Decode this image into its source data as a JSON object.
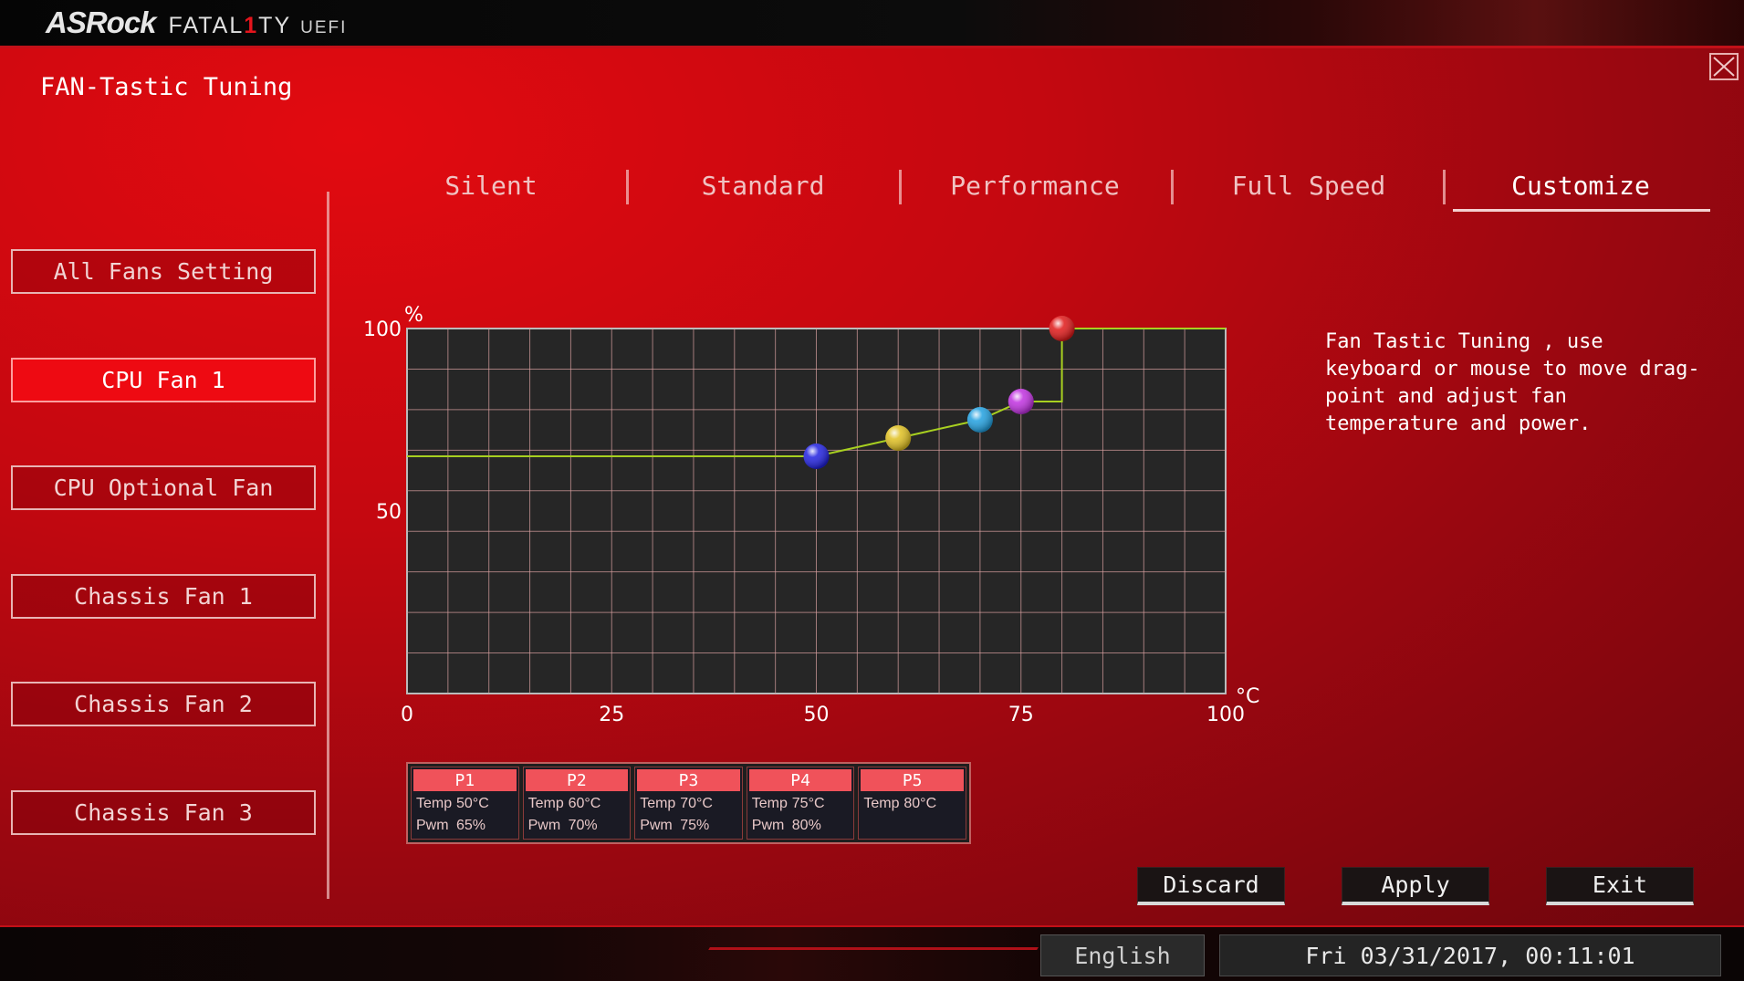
{
  "header": {
    "brand": "ASRock",
    "brand_sub_a": "FATAL",
    "brand_sub_one": "1",
    "brand_sub_b": "TY",
    "brand_uefi": "UEFI"
  },
  "page": {
    "title": "FAN-Tastic Tuning"
  },
  "sidebar": {
    "items": [
      {
        "label": "All Fans Setting",
        "active": false
      },
      {
        "label": "CPU Fan 1",
        "active": true
      },
      {
        "label": "CPU Optional Fan",
        "active": false
      },
      {
        "label": "Chassis Fan 1",
        "active": false
      },
      {
        "label": "Chassis Fan 2",
        "active": false
      },
      {
        "label": "Chassis Fan 3",
        "active": false
      }
    ]
  },
  "tabs": [
    {
      "label": "Silent",
      "active": false
    },
    {
      "label": "Standard",
      "active": false
    },
    {
      "label": "Performance",
      "active": false
    },
    {
      "label": "Full Speed",
      "active": false
    },
    {
      "label": "Customize",
      "active": true
    }
  ],
  "chart_data": {
    "type": "line",
    "y_unit": "%",
    "x_unit": "°C",
    "xlim": [
      0,
      100
    ],
    "ylim": [
      0,
      100
    ],
    "x_ticks": [
      "0",
      "25",
      "50",
      "75",
      "100"
    ],
    "y_ticks": [
      "100",
      "50"
    ],
    "grid": true,
    "curve": [
      {
        "x": 0,
        "y": 65
      },
      {
        "x": 50,
        "y": 65
      },
      {
        "x": 60,
        "y": 70
      },
      {
        "x": 70,
        "y": 75
      },
      {
        "x": 75,
        "y": 80
      },
      {
        "x": 80,
        "y": 80
      },
      {
        "x": 80,
        "y": 100
      },
      {
        "x": 100,
        "y": 100
      }
    ],
    "points": [
      {
        "name": "P1",
        "x": 50,
        "y": 65,
        "color": "#2020e0"
      },
      {
        "name": "P2",
        "x": 60,
        "y": 70,
        "color": "#e0c020"
      },
      {
        "name": "P3",
        "x": 70,
        "y": 75,
        "color": "#20a0e0"
      },
      {
        "name": "P4",
        "x": 75,
        "y": 80,
        "color": "#c030e0"
      },
      {
        "name": "P5",
        "x": 80,
        "y": 100,
        "color": "#e01818"
      }
    ]
  },
  "points_table": [
    {
      "name": "P1",
      "temp_label": "Temp",
      "temp": "50°C",
      "pwm_label": "Pwm",
      "pwm": "65%"
    },
    {
      "name": "P2",
      "temp_label": "Temp",
      "temp": "60°C",
      "pwm_label": "Pwm",
      "pwm": "70%"
    },
    {
      "name": "P3",
      "temp_label": "Temp",
      "temp": "70°C",
      "pwm_label": "Pwm",
      "pwm": "75%"
    },
    {
      "name": "P4",
      "temp_label": "Temp",
      "temp": "75°C",
      "pwm_label": "Pwm",
      "pwm": "80%"
    },
    {
      "name": "P5",
      "temp_label": "Temp",
      "temp": "80°C",
      "pwm_label": "",
      "pwm": ""
    }
  ],
  "description": "Fan Tastic Tuning , use keyboard or mouse to move drag-point and adjust fan temperature and power.",
  "actions": {
    "discard": "Discard",
    "apply": "Apply",
    "exit": "Exit"
  },
  "footer": {
    "language": "English",
    "datetime": "Fri 03/31/2017, 00:11:01"
  },
  "colors": {
    "accent": "#e20a10",
    "active_item": "#ee0a12",
    "curve": "#a8d020"
  }
}
